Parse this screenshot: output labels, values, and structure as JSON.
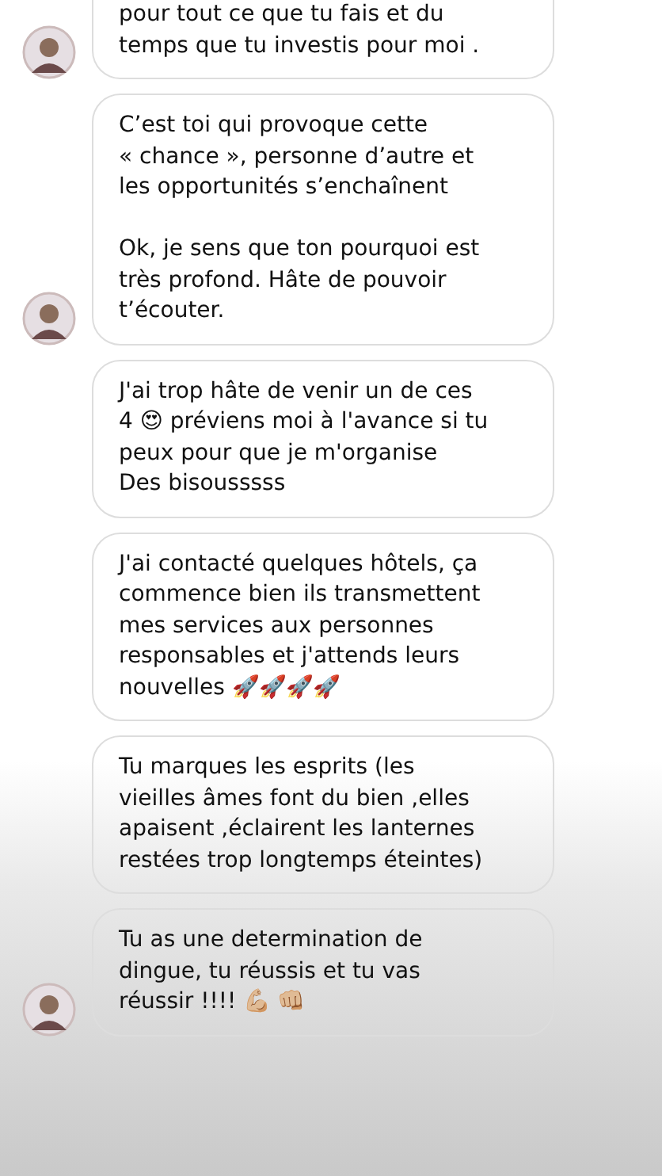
{
  "messages": [
    {
      "text": "pour tout ce que tu fais et du\ntemps que tu investis pour moi .",
      "avatar": true,
      "cut_top": true
    },
    {
      "text": "C’est toi qui provoque cette\n« chance », personne d’autre et\nles opportunités s’enchaînent\n\nOk, je sens que ton pourquoi est\ntrès profond. Hâte de pouvoir\nt’écouter.",
      "avatar": true,
      "cut_top": false
    },
    {
      "text": "J'ai trop hâte de venir un de ces\n4 😍 préviens moi à l'avance si tu\npeux pour que je m'organise\nDes bisousssss",
      "avatar": false,
      "cut_top": false
    },
    {
      "text": "J'ai contacté quelques hôtels,  ça\ncommence bien ils transmettent\nmes services aux personnes\nresponsables et j'attends leurs\nnouvelles 🚀🚀🚀🚀",
      "avatar": false,
      "cut_top": false
    },
    {
      "text": "Tu marques les esprits (les\nvieilles âmes font du bien ,elles\napaisent ,éclairent les lanternes\nrestées trop longtemps éteintes)",
      "avatar": false,
      "cut_top": false
    },
    {
      "text": "Tu as une determination de\ndingue, tu réussis et tu vas\nréussir !!!! 💪🏼 👊🏼",
      "avatar": true,
      "cut_top": false
    }
  ]
}
